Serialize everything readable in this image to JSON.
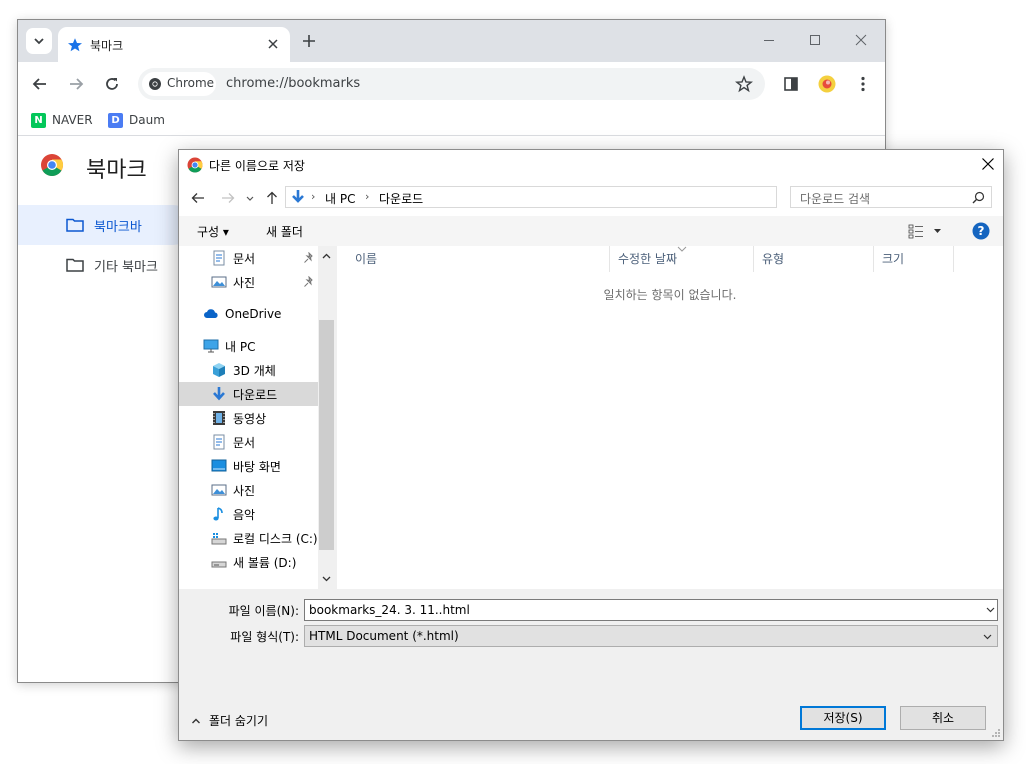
{
  "browser": {
    "tab": {
      "title": "북마크"
    },
    "omnibox": {
      "chip_label": "Chrome",
      "url": "chrome://bookmarks"
    },
    "bookmarks_bar": [
      {
        "label": "NAVER",
        "logo_letter": "N",
        "color": "#03c75a"
      },
      {
        "label": "Daum",
        "logo_letter": "D",
        "color": "#4b7cf3"
      }
    ],
    "page": {
      "title": "북마크",
      "sidebar": [
        {
          "label": "북마크바",
          "active": true
        },
        {
          "label": "기타 북마크",
          "active": false
        }
      ]
    },
    "accent_color": "#1a73e8"
  },
  "dialog": {
    "title": "다른 이름으로 저장",
    "breadcrumb": [
      "내 PC",
      "다운로드"
    ],
    "search_placeholder": "다운로드 검색",
    "commands": {
      "organize": "구성",
      "new_folder": "새 폴더"
    },
    "nav_items": [
      {
        "label": "문서",
        "icon": "document-icon",
        "pinned": true
      },
      {
        "label": "사진",
        "icon": "picture-icon",
        "pinned": true
      },
      {
        "label": "OneDrive",
        "icon": "cloud-icon"
      },
      {
        "label": "내 PC",
        "icon": "computer-icon"
      },
      {
        "label": "3D 개체",
        "icon": "cube-icon"
      },
      {
        "label": "다운로드",
        "icon": "download-arrow-icon",
        "selected": true
      },
      {
        "label": "동영상",
        "icon": "film-icon"
      },
      {
        "label": "문서",
        "icon": "document-icon"
      },
      {
        "label": "바탕 화면",
        "icon": "desktop-icon"
      },
      {
        "label": "사진",
        "icon": "picture-icon"
      },
      {
        "label": "음악",
        "icon": "music-note-icon"
      },
      {
        "label": "로컬 디스크 (C:)",
        "icon": "drive-icon"
      },
      {
        "label": "새 볼륨 (D:)",
        "icon": "drive-icon"
      }
    ],
    "columns": [
      "이름",
      "수정한 날짜",
      "유형",
      "크기"
    ],
    "empty_message": "일치하는 항목이 없습니다.",
    "file_name": {
      "label": "파일 이름(N):",
      "value": "bookmarks_24. 3. 11..html"
    },
    "file_type": {
      "label": "파일 형식(T):",
      "value": "HTML Document (*.html)"
    },
    "hide_folders_label": "폴더 숨기기",
    "buttons": {
      "save": "저장(S)",
      "cancel": "취소"
    },
    "accent_color": "#0078d7"
  }
}
